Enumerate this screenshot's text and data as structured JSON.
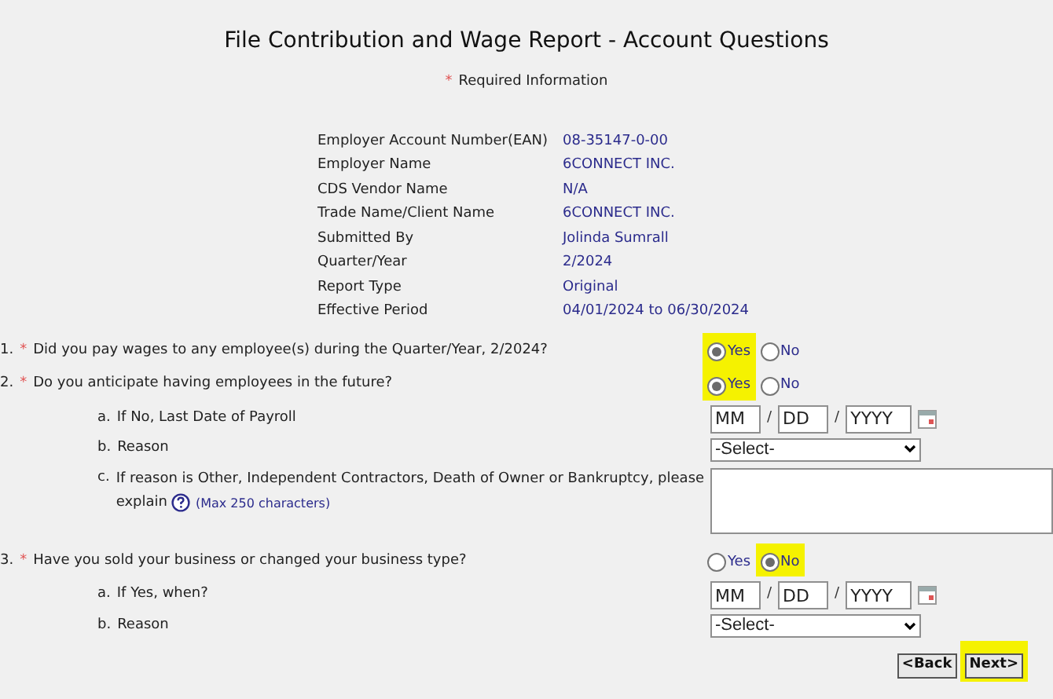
{
  "title": "File Contribution and Wage Report - Account Questions",
  "required_note": {
    "mark": "*",
    "text": "Required Information"
  },
  "account_info": [
    {
      "label": "Employer Account Number(EAN)",
      "value": "08-35147-0-00"
    },
    {
      "label": "Employer Name",
      "value": "6CONNECT INC."
    },
    {
      "label": "CDS Vendor Name",
      "value": "N/A"
    },
    {
      "label": "Trade Name/Client Name",
      "value": "6CONNECT INC."
    },
    {
      "label": "Submitted By",
      "value": "Jolinda Sumrall"
    },
    {
      "label": "Quarter/Year",
      "value": "2/2024"
    },
    {
      "label": "Report Type",
      "value": "Original"
    },
    {
      "label": "Effective Period",
      "value": "04/01/2024 to 06/30/2024"
    }
  ],
  "questions": [
    {
      "number": "1.",
      "required_mark": "*",
      "text": "Did you pay wages to any employee(s) during the Quarter/Year, 2/2024?",
      "options": [
        {
          "label": "Yes",
          "selected": true,
          "highlighted": true
        },
        {
          "label": "No",
          "selected": false,
          "highlighted": false
        }
      ]
    },
    {
      "number": "2.",
      "required_mark": "*",
      "text": "Do you anticipate having employees in the future?",
      "options": [
        {
          "label": "Yes",
          "selected": true,
          "highlighted": true
        },
        {
          "label": "No",
          "selected": false,
          "highlighted": false
        }
      ],
      "sub_items": [
        {
          "kind": "date",
          "letter": "a.",
          "text": "If No, Last Date of Payroll",
          "month_placeholder": "MM",
          "day_placeholder": "DD",
          "year_placeholder": "YYYY",
          "separator": "/"
        },
        {
          "kind": "select",
          "letter": "b.",
          "text": "Reason",
          "value": "-Select-"
        },
        {
          "kind": "textarea",
          "letter": "c.",
          "text": "If reason is Other, Independent Contractors, Death of Owner or Bankruptcy, please",
          "text_line_2": "explain",
          "hint": "(Max 250 characters)"
        }
      ]
    },
    {
      "number": "3.",
      "required_mark": "*",
      "text": "Have you sold your business or changed your business type?",
      "options": [
        {
          "label": "Yes",
          "selected": false,
          "highlighted": false
        },
        {
          "label": "No",
          "selected": true,
          "highlighted": true
        }
      ],
      "sub_items": [
        {
          "kind": "date",
          "letter": "a.",
          "text": "If Yes, when?",
          "month_placeholder": "MM",
          "day_placeholder": "DD",
          "year_placeholder": "YYYY",
          "separator": "/"
        },
        {
          "kind": "select",
          "letter": "b.",
          "text": "Reason",
          "value": "-Select-"
        }
      ]
    }
  ],
  "buttons": [
    {
      "label": "<Back",
      "highlighted": false
    },
    {
      "label": "Next>",
      "highlighted": true
    }
  ]
}
